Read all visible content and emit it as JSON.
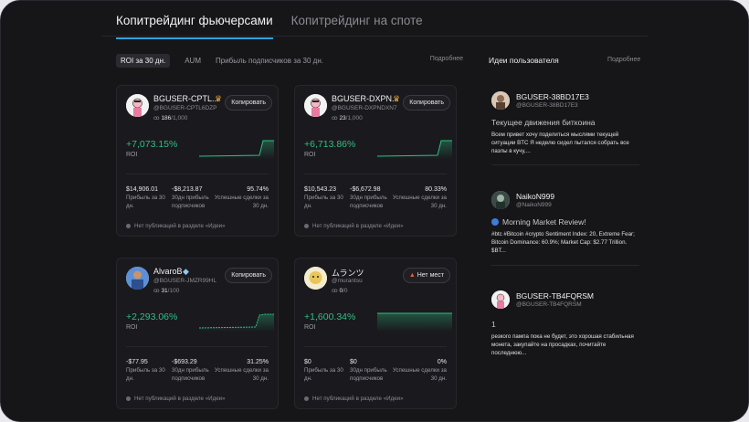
{
  "tabs": [
    {
      "label": "Копитрейдинг фьючерсами",
      "active": true
    },
    {
      "label": "Копитрейдинг на споте",
      "active": false
    }
  ],
  "filters": [
    "ROI за 30 дн.",
    "AUM",
    "Прибыль подписчиков за 30 дн."
  ],
  "more_label": "Подробнее",
  "cards": [
    {
      "name": "BGUSER-CPTL...",
      "handle": "@BGUSER-CPTL6DZP",
      "subs_count": "186",
      "subs_total": "/1,000",
      "button": "Копировать",
      "roi": "+7,073.15%",
      "roi_label": "ROI",
      "stats": [
        {
          "value": "$14,906.01",
          "label": "Прибыль за 30 дн."
        },
        {
          "value": "-$8,213.87",
          "label": "30дн прибыль подписчиков"
        },
        {
          "value": "95.74%",
          "label": "Успешные сделки за 30 дн."
        }
      ],
      "no_pub": "Нет публикаций в разделе «Идеи»"
    },
    {
      "name": "BGUSER-DXPN...",
      "handle": "@BGUSER-DXPNDXN7",
      "subs_count": "23",
      "subs_total": "/1,000",
      "button": "Копировать",
      "roi": "+6,713.86%",
      "roi_label": "ROI",
      "stats": [
        {
          "value": "$10,543.23",
          "label": "Прибыль за 30 дн."
        },
        {
          "value": "-$6,672.98",
          "label": "30дн прибыль подписчиков"
        },
        {
          "value": "80.33%",
          "label": "Успешные сделки за 30 дн."
        }
      ],
      "no_pub": "Нет публикаций в разделе «Идеи»"
    },
    {
      "name": "AlvaroB",
      "handle": "@BGUSER-JMZR99HL",
      "subs_count": "31",
      "subs_total": "/100",
      "button": "Копировать",
      "roi": "+2,293.06%",
      "roi_label": "ROI",
      "stats": [
        {
          "value": "-$77.95",
          "label": "Прибыль за 30 дн."
        },
        {
          "value": "-$693.29",
          "label": "30дн прибыль подписчиков"
        },
        {
          "value": "31.25%",
          "label": "Успешные сделки за 30 дн."
        }
      ],
      "no_pub": "Нет публикаций в разделе «Идеи»"
    },
    {
      "name": "ムランツ",
      "handle": "@murantsu",
      "subs_count": "0",
      "subs_total": "/0",
      "button": "Нет мест",
      "roi": "+1,600.34%",
      "roi_label": "ROI",
      "stats": [
        {
          "value": "$0",
          "label": "Прибыль за 30 дн."
        },
        {
          "value": "$0",
          "label": "30дн прибыль подписчиков"
        },
        {
          "value": "0%",
          "label": "Успешные сделки за 30 дн."
        }
      ],
      "no_pub": "Нет публикаций в разделе «Идеи»"
    }
  ],
  "ideas": {
    "title": "Идеи пользователя",
    "more": "Подробнее",
    "items": [
      {
        "name": "BGUSER-38BD17E3",
        "handle": "@BGUSER-38BD17E3",
        "title": "Текущее движения биткоина",
        "body": "Всем привет хочу поделиться мыслями текущей ситуации BTC Я неделю сидел пытался собрать все пазлы в кучу,..."
      },
      {
        "name": "NaikoN999",
        "handle": "@NaikoN999",
        "title": "Morning Market Review!",
        "body": "#btc #Bitcoin #crypto Sentiment Index: 20, Extreme Fear; Bitcoin Dominance: 60.9%; Market Cap: $2.77 Trillion. $BT..."
      },
      {
        "name": "BGUSER-TB4FQRSM",
        "handle": "@BGUSER-TB4FQRSM",
        "title": "1",
        "body": "резкого пампа пока не будет, это хорошая стабильная монета, закупайте на просадках, почитайте последнюю..."
      }
    ]
  },
  "colors": {
    "accent": "#2fa3d9",
    "positive": "#2ebf82",
    "bg": "#161619"
  }
}
